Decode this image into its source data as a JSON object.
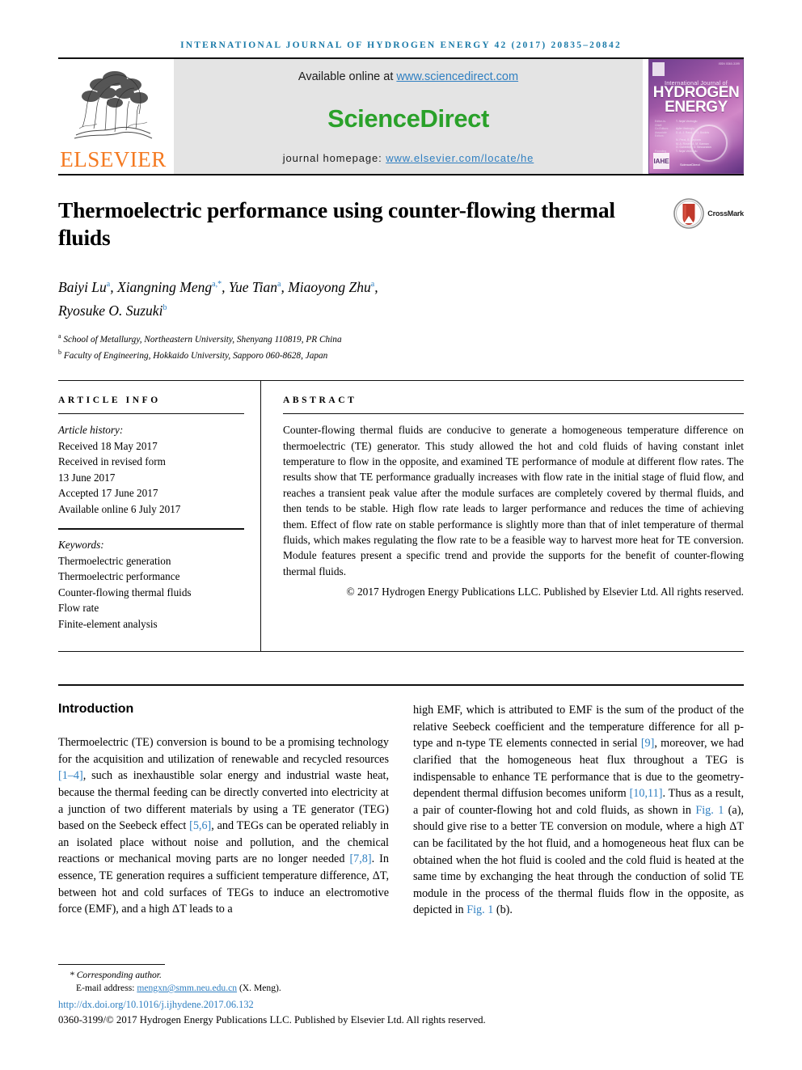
{
  "running_head": "International Journal of Hydrogen Energy 42 (2017) 20835–20842",
  "masthead": {
    "elsevier_wordmark": "ELSEVIER",
    "available_prefix": "Available online at ",
    "available_link": "www.sciencedirect.com",
    "sciencedirect_logo": "ScienceDirect",
    "homepage_prefix": "journal homepage: ",
    "homepage_link": "www.elsevier.com/locate/he",
    "cover": {
      "issn": "ISSN 0360-3199",
      "small_title": "International Journal of",
      "big_title_line1": "HYDROGEN",
      "big_title_line2": "ENERGY",
      "meta": [
        {
          "key": "Editor-in-Chief:",
          "value": "T. Nejat Veziroglu"
        },
        {
          "key": "Co-Editors:",
          "value": "Ayfer Veziroglu"
        },
        {
          "key": "Associate Editors:",
          "value": "D. A. J. Rand, J. O. Bockris"
        },
        {
          "key": "",
          "value": "N. Peral, B. Baykara"
        },
        {
          "key": "",
          "value": "M. A. Rosen, A. M. Kannan"
        },
        {
          "key": "",
          "value": "G. Gahleitner, D. Bessarabov"
        },
        {
          "key": "Founding Editor:",
          "value": "T. Nejat Veziroglu"
        }
      ],
      "institute_logo": "IAHE",
      "publisher": "ScienceDirect"
    }
  },
  "article": {
    "title": "Thermoelectric performance using counter-flowing thermal fluids",
    "crossmark": "CrossMark",
    "authors_line1": "Baiyi Lu ᵃ, Xiangning Meng ᵃ˒*, Yue Tian ᵃ, Miaoyong Zhu ᵃ,",
    "authors": [
      {
        "name": "Baiyi Lu",
        "marks": "a"
      },
      {
        "name": "Xiangning Meng",
        "marks": "a,*"
      },
      {
        "name": "Yue Tian",
        "marks": "a"
      },
      {
        "name": "Miaoyong Zhu",
        "marks": "a"
      },
      {
        "name": "Ryosuke O. Suzuki",
        "marks": "b"
      }
    ],
    "affiliations": [
      {
        "mark": "a",
        "text": "School of Metallurgy, Northeastern University, Shenyang 110819, PR China"
      },
      {
        "mark": "b",
        "text": "Faculty of Engineering, Hokkaido University, Sapporo 060-8628, Japan"
      }
    ]
  },
  "article_info": {
    "label": "Article info",
    "history_heading": "Article history:",
    "history": [
      "Received 18 May 2017",
      "Received in revised form",
      "13 June 2017",
      "Accepted 17 June 2017",
      "Available online 6 July 2017"
    ],
    "keywords_heading": "Keywords:",
    "keywords": [
      "Thermoelectric generation",
      "Thermoelectric performance",
      "Counter-flowing thermal fluids",
      "Flow rate",
      "Finite-element analysis"
    ]
  },
  "abstract": {
    "label": "Abstract",
    "text": "Counter-flowing thermal fluids are conducive to generate a homogeneous temperature difference on thermoelectric (TE) generator. This study allowed the hot and cold fluids of having constant inlet temperature to flow in the opposite, and examined TE performance of module at different flow rates. The results show that TE performance gradually increases with flow rate in the initial stage of fluid flow, and reaches a transient peak value after the module surfaces are completely covered by thermal fluids, and then tends to be stable. High flow rate leads to larger performance and reduces the time of achieving them. Effect of flow rate on stable performance is slightly more than that of inlet temperature of thermal fluids, which makes regulating the flow rate to be a feasible way to harvest more heat for TE conversion. Module features present a specific trend and provide the supports for the benefit of counter-flowing thermal fluids.",
    "copyright": "© 2017 Hydrogen Energy Publications LLC. Published by Elsevier Ltd. All rights reserved."
  },
  "body": {
    "section_title": "Introduction",
    "left_paragraph_parts": [
      {
        "t": "Thermoelectric (TE) conversion is bound to be a promising technology for the acquisition and utilization of renewable and recycled resources ",
        "link": false
      },
      {
        "t": "[1–4]",
        "link": true
      },
      {
        "t": ", such as inexhaustible solar energy and industrial waste heat, because the thermal feeding can be directly converted into electricity at a junction of two different materials by using a TE generator (TEG) based on the Seebeck effect ",
        "link": false
      },
      {
        "t": "[5,6]",
        "link": true
      },
      {
        "t": ", and TEGs can be operated reliably in an isolated place without noise and pollution, and the chemical reactions or mechanical moving parts are no longer needed ",
        "link": false
      },
      {
        "t": "[7,8]",
        "link": true
      },
      {
        "t": ". In essence, TE generation requires a sufficient temperature difference, ΔT, between hot and cold surfaces of TEGs to induce an electromotive force (EMF), and a high ΔT leads to a",
        "link": false
      }
    ],
    "right_paragraph_parts": [
      {
        "t": "high EMF, which is attributed to EMF is the sum of the product of the relative Seebeck coefficient and the temperature difference for all p-type and n-type TE elements connected in serial ",
        "link": false
      },
      {
        "t": "[9]",
        "link": true
      },
      {
        "t": ", moreover, we had clarified that the homogeneous heat flux throughout a TEG is indispensable to enhance TE performance that is due to the geometry-dependent thermal diffusion becomes uniform ",
        "link": false
      },
      {
        "t": "[10,11]",
        "link": true
      },
      {
        "t": ". Thus as a result, a pair of counter-flowing hot and cold fluids, as shown in ",
        "link": false
      },
      {
        "t": "Fig. 1",
        "link": true
      },
      {
        "t": " (a), should give rise to a better TE conversion on module, where a high ΔT can be facilitated by the hot fluid, and a homogeneous heat flux can be obtained when the hot fluid is cooled and the cold fluid is heated at the same time by exchanging the heat through the conduction of solid TE module in the process of the thermal fluids flow in the opposite, as depicted in ",
        "link": false
      },
      {
        "t": "Fig. 1",
        "link": true
      },
      {
        "t": " (b).",
        "link": false
      }
    ]
  },
  "footnote": {
    "corresponding": "* Corresponding author.",
    "email_label": "E-mail address: ",
    "email": "mengxn@smm.neu.edu.cn",
    "email_suffix": " (X. Meng).",
    "doi": "http://dx.doi.org/10.1016/j.ijhydene.2017.06.132",
    "issn_line": "0360-3199/© 2017 Hydrogen Energy Publications LLC. Published by Elsevier Ltd. All rights reserved."
  },
  "colors": {
    "link": "#2f7fc1",
    "elsevier_orange": "#F47920",
    "sciencedirect_green": "#2aa12a",
    "running_head": "#1a7aa8"
  }
}
